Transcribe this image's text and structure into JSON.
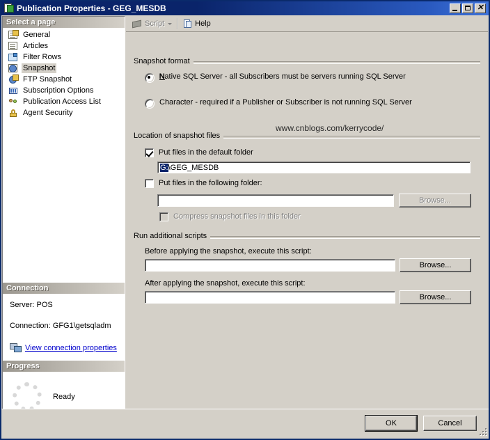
{
  "window": {
    "title": "Publication Properties - GEG_MESDB",
    "icon": "publication-properties-icon",
    "minimize_label": "Minimize",
    "maximize_label": "Maximize",
    "close_label": "Close"
  },
  "sidebar": {
    "header": "Select a page",
    "items": [
      {
        "label": "General",
        "icon": "general-page-icon",
        "selected": false
      },
      {
        "label": "Articles",
        "icon": "articles-page-icon",
        "selected": false
      },
      {
        "label": "Filter Rows",
        "icon": "filter-rows-page-icon",
        "selected": false
      },
      {
        "label": "Snapshot",
        "icon": "snapshot-page-icon",
        "selected": true
      },
      {
        "label": "FTP Snapshot",
        "icon": "ftp-snapshot-page-icon",
        "selected": false
      },
      {
        "label": "Subscription Options",
        "icon": "subscription-options-page-icon",
        "selected": false
      },
      {
        "label": "Publication Access List",
        "icon": "publication-access-list-page-icon",
        "selected": false
      },
      {
        "label": "Agent Security",
        "icon": "agent-security-page-icon",
        "selected": false
      }
    ],
    "connection": {
      "header": "Connection",
      "server": "Server: POS",
      "connection": "Connection: GFG1\\getsqladm",
      "view_properties_link": "View connection properties",
      "link_icon": "connection-properties-icon"
    },
    "progress": {
      "header": "Progress",
      "status": "Ready",
      "spinner_icon": "progress-spinner-icon"
    }
  },
  "toolbar": {
    "script_label": "Script",
    "script_icon": "script-icon",
    "script_dropdown_icon": "chevron-down-icon",
    "help_label": "Help",
    "help_icon": "help-icon"
  },
  "watermark": "www.cnblogs.com/kerrycode/",
  "main": {
    "snapshot_format": {
      "legend": "Snapshot format",
      "options": [
        {
          "label": "Native SQL Server - all Subscribers must be servers running SQL Server",
          "selected": true
        },
        {
          "label": "Character - required if a Publisher or Subscriber is not running SQL Server",
          "selected": false
        }
      ]
    },
    "location_of_snapshot_files": {
      "legend": "Location of snapshot files",
      "default_folder_checkbox": {
        "label": "Put files in the default folder",
        "checked": true
      },
      "default_folder_value_selected": "G:",
      "default_folder_value_rest": "\\GEG_MESDB",
      "following_folder_checkbox": {
        "label": "Put files in the following folder:",
        "checked": false
      },
      "following_folder_value": "",
      "following_folder_browse": "Browse...",
      "compress_checkbox": {
        "label": "Compress snapshot files in this folder",
        "checked": false,
        "disabled": true
      }
    },
    "run_additional_scripts": {
      "legend": "Run additional scripts",
      "before_label": "Before applying the snapshot, execute this script:",
      "before_value": "",
      "before_browse": "Browse...",
      "after_label": "After applying the snapshot, execute this script:",
      "after_value": "",
      "after_browse": "Browse..."
    }
  },
  "footer": {
    "ok_label": "OK",
    "cancel_label": "Cancel"
  },
  "colors": {
    "titlebar": "#0a246a",
    "face": "#d4d0c8",
    "selection": "#0a246a",
    "link": "#0000cc"
  }
}
